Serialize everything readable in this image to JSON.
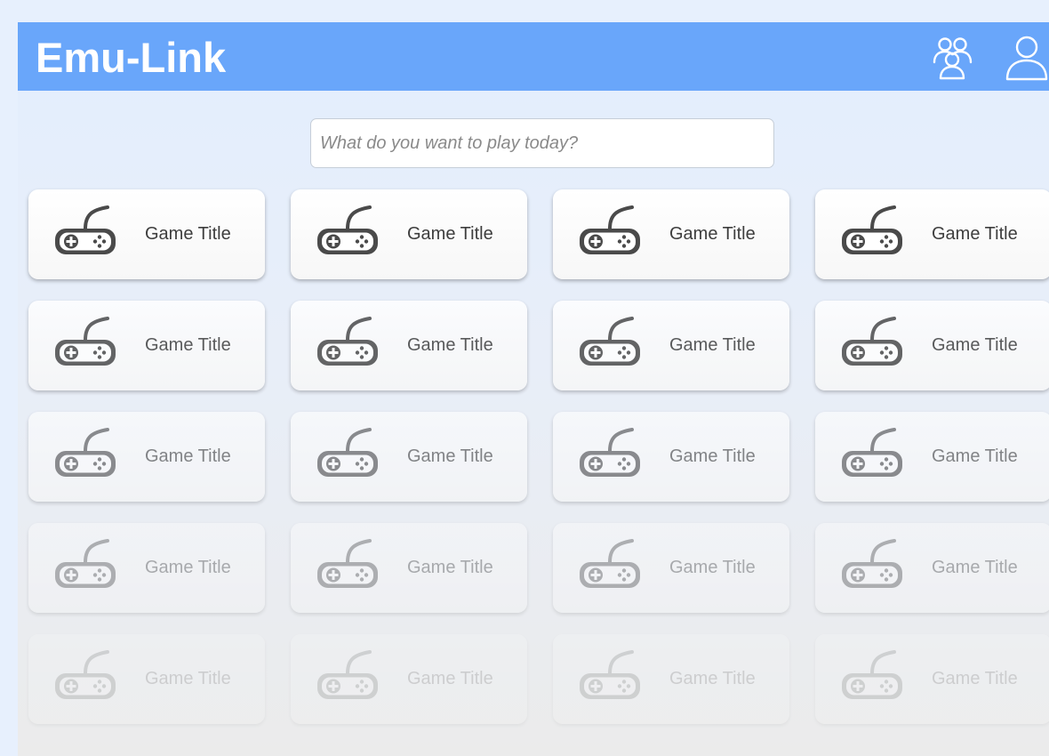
{
  "app": {
    "title": "Emu-Link",
    "header_color": "#69a6fa",
    "icons": [
      "friends-icon",
      "profile-icon"
    ]
  },
  "search": {
    "placeholder": "What do you want to play today?",
    "value": ""
  },
  "games": [
    {
      "title": "Game Title",
      "icon": "gamepad-icon"
    },
    {
      "title": "Game Title",
      "icon": "gamepad-icon"
    },
    {
      "title": "Game Title",
      "icon": "gamepad-icon"
    },
    {
      "title": "Game Title",
      "icon": "gamepad-icon"
    },
    {
      "title": "Game Title",
      "icon": "gamepad-icon"
    },
    {
      "title": "Game Title",
      "icon": "gamepad-icon"
    },
    {
      "title": "Game Title",
      "icon": "gamepad-icon"
    },
    {
      "title": "Game Title",
      "icon": "gamepad-icon"
    },
    {
      "title": "Game Title",
      "icon": "gamepad-icon"
    },
    {
      "title": "Game Title",
      "icon": "gamepad-icon"
    },
    {
      "title": "Game Title",
      "icon": "gamepad-icon"
    },
    {
      "title": "Game Title",
      "icon": "gamepad-icon"
    },
    {
      "title": "Game Title",
      "icon": "gamepad-icon"
    },
    {
      "title": "Game Title",
      "icon": "gamepad-icon"
    },
    {
      "title": "Game Title",
      "icon": "gamepad-icon"
    },
    {
      "title": "Game Title",
      "icon": "gamepad-icon"
    },
    {
      "title": "Game Title",
      "icon": "gamepad-icon"
    },
    {
      "title": "Game Title",
      "icon": "gamepad-icon"
    },
    {
      "title": "Game Title",
      "icon": "gamepad-icon"
    },
    {
      "title": "Game Title",
      "icon": "gamepad-icon"
    }
  ]
}
